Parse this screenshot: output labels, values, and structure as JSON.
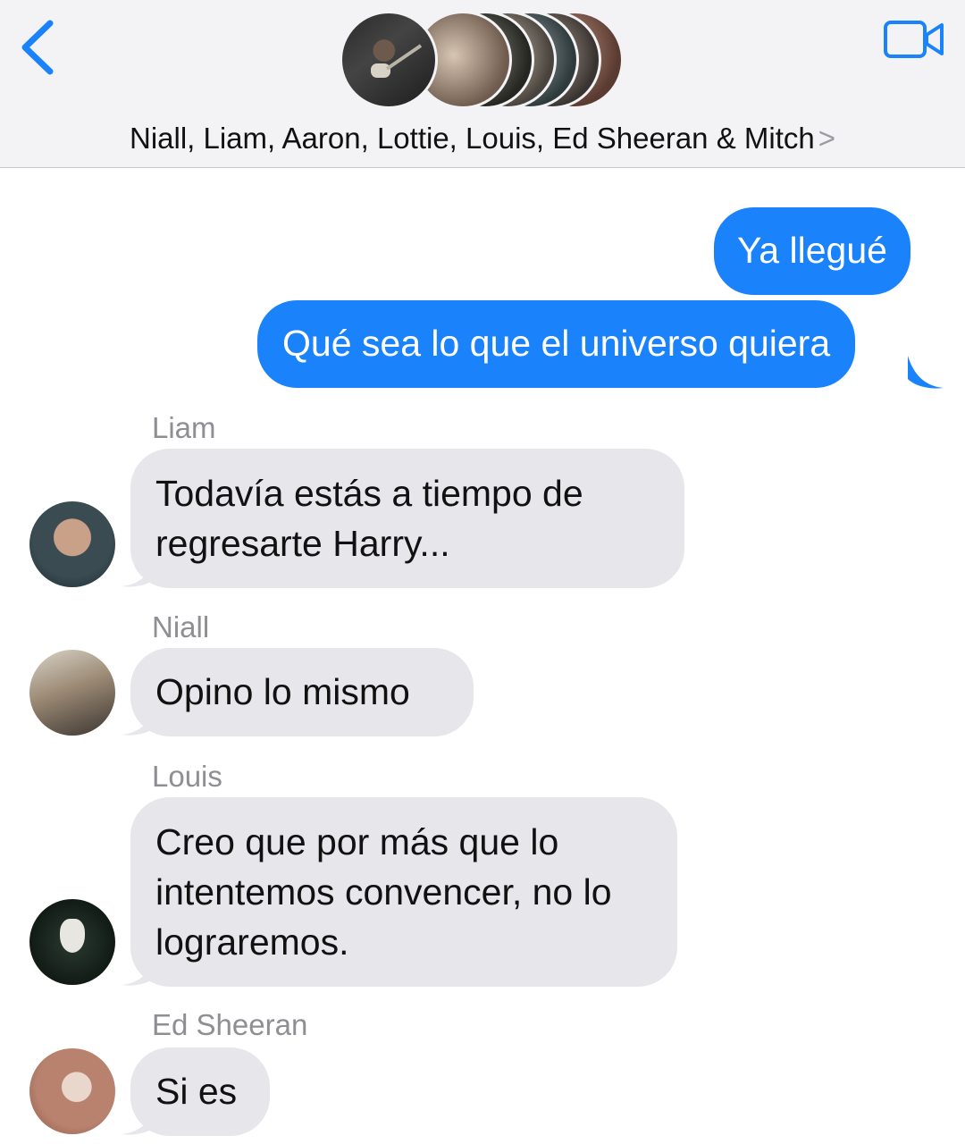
{
  "header": {
    "group_title": "Niall, Liam, Aaron, Lottie, Louis, Ed Sheeran & Mitch",
    "chevron": ">"
  },
  "colors": {
    "accent": "#1a82fb",
    "sent_bubble": "#1a82fb",
    "received_bubble": "#e6e6eb",
    "sender_name": "#8e8e93"
  },
  "icons": [
    "back-chevron-icon",
    "video-camera-icon",
    "group-avatar-stack"
  ],
  "messages": [
    {
      "direction": "sent",
      "text": "Ya llegué"
    },
    {
      "direction": "sent",
      "text": "Qué sea lo que el universo quiera"
    },
    {
      "direction": "received",
      "sender": "Liam",
      "text": "Todavía estás a tiempo de regresarte Harry..."
    },
    {
      "direction": "received",
      "sender": "Niall",
      "text": "Opino lo mismo"
    },
    {
      "direction": "received",
      "sender": "Louis",
      "text": "Creo que por más que lo intentemos convencer, no lo lograremos."
    },
    {
      "direction": "received",
      "sender": "Ed Sheeran",
      "text": "Si es"
    }
  ]
}
